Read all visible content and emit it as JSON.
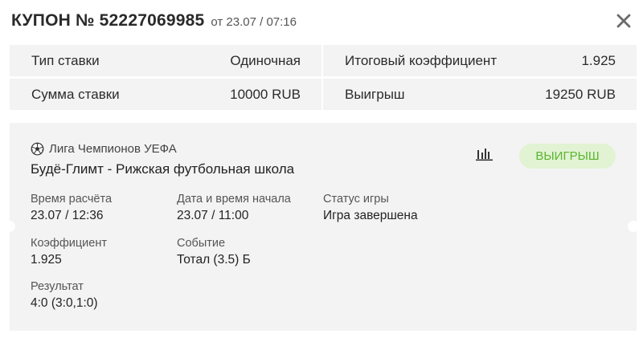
{
  "coupon": {
    "title": "КУПОН № 52227069985",
    "date": "от 23.07 / 07:16"
  },
  "summary": {
    "bet_type_label": "Тип ставки",
    "bet_type_value": "Одиночная",
    "total_coef_label": "Итоговый коэффициент",
    "total_coef_value": "1.925",
    "stake_label": "Сумма ставки",
    "stake_value": "10000 RUB",
    "win_label": "Выигрыш",
    "win_value": "19250 RUB"
  },
  "event": {
    "league_icon": "soccer-ball-icon",
    "league": "Лига Чемпионов УЕФА",
    "match": "Будё-Глимт - Рижская футбольная школа",
    "stats_icon": "bar-chart-icon",
    "status_badge": "ВЫИГРЫШ",
    "fields": {
      "settle_time_label": "Время расчёта",
      "settle_time_value": "23.07 / 12:36",
      "start_time_label": "Дата и время начала",
      "start_time_value": "23.07 / 11:00",
      "game_status_label": "Статус игры",
      "game_status_value": "Игра завершена",
      "coef_label": "Коэффициент",
      "coef_value": "1.925",
      "outcome_label": "Событие",
      "outcome_value": "Тотал (3.5) Б",
      "result_label": "Результат",
      "result_value": "4:0 (3:0,1:0)"
    }
  },
  "colors": {
    "badge_bg": "#e1f3d3",
    "badge_text": "#5bb530",
    "panel_bg": "#f3f3f3"
  }
}
